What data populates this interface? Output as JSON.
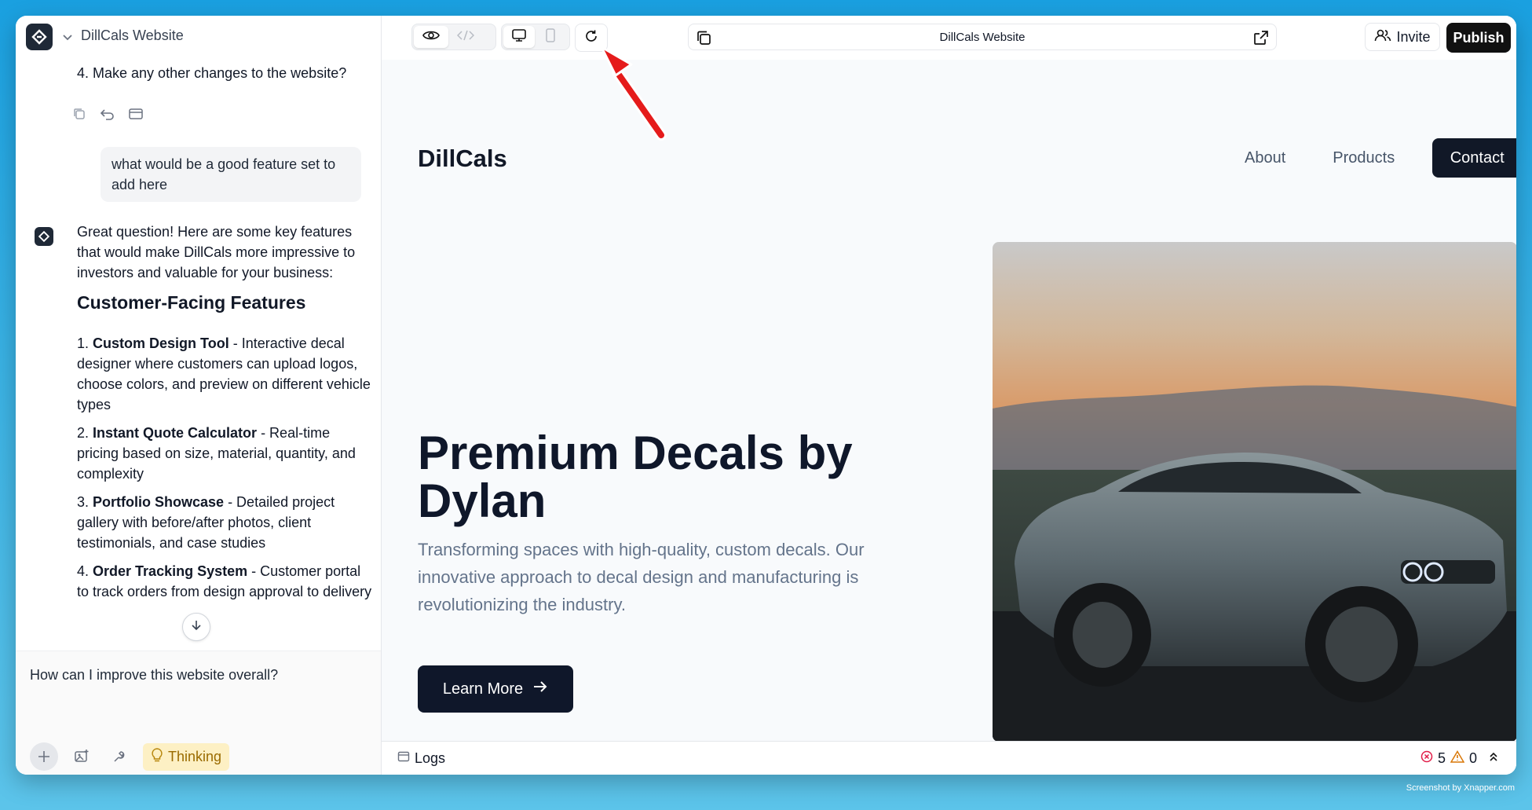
{
  "sidebar": {
    "project_title": "DillCals Website",
    "previous_message_tail": "4. Make any other changes to the website?",
    "user_message": "what would be a good feature set to add here",
    "assistant": {
      "intro": "Great question! Here are some key features that would make DillCals more impressive to investors and valuable for your business:",
      "heading": "Customer-Facing Features",
      "items": [
        {
          "num": "1.",
          "title": "Custom Design Tool",
          "text": " - Interactive decal designer where customers can upload logos, choose colors, and preview on different vehicle types"
        },
        {
          "num": "2.",
          "title": "Instant Quote Calculator",
          "text": " - Real-time pricing based on size, material, quantity, and complexity"
        },
        {
          "num": "3.",
          "title": "Portfolio Showcase",
          "text": " - Detailed project gallery with before/after photos, client testimonials, and case studies"
        },
        {
          "num": "4.",
          "title": "Order Tracking System",
          "text": " - Customer portal to track orders from design approval to delivery"
        }
      ]
    },
    "composer": {
      "input_value": "How can I improve this website overall?",
      "thinking_label": "Thinking"
    }
  },
  "toolbar": {
    "url_title": "DillCals Website",
    "invite_label": "Invite",
    "publish_label": "Publish"
  },
  "site": {
    "brand": "DillCals",
    "nav": {
      "about": "About",
      "products": "Products",
      "contact": "Contact"
    },
    "hero_title": "Premium Decals by Dylan",
    "hero_subtitle": "Transforming spaces with high-quality, custom decals. Our innovative approach to decal design and manufacturing is revolutionizing the industry.",
    "hero_button": "Learn More"
  },
  "logs": {
    "label": "Logs",
    "error_count": "5",
    "warning_count": "0"
  },
  "watermark": "Screenshot by Xnapper.com",
  "colors": {
    "accent_dark": "#0f172a",
    "thinking_bg": "#fdf0c4",
    "annotation_arrow": "#e51b1b"
  }
}
